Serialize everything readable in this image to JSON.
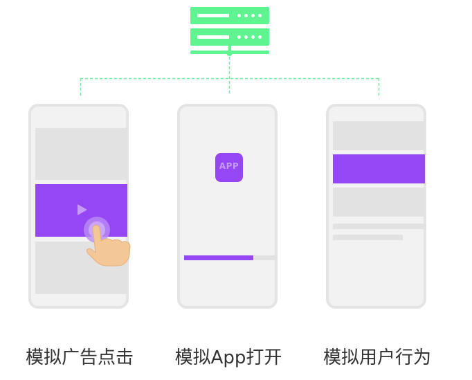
{
  "diagram": {
    "colors": {
      "server": "#5ef590",
      "connector": "#6fe8a0",
      "accent": "#9547f5",
      "phone_bg": "#f2f2f2",
      "phone_border": "#e4e4e4",
      "placeholder": "#e2e2e2"
    },
    "server": {
      "icon": "server-icon"
    },
    "phones": [
      {
        "icon": "play-icon",
        "pointer": "hand-pointer-icon"
      },
      {
        "app_label": "APP",
        "progress": 0.75
      },
      {
        "highlight": "selected-list-item"
      }
    ],
    "captions": [
      "模拟广告点击",
      "模拟App打开",
      "模拟用户行为"
    ]
  }
}
